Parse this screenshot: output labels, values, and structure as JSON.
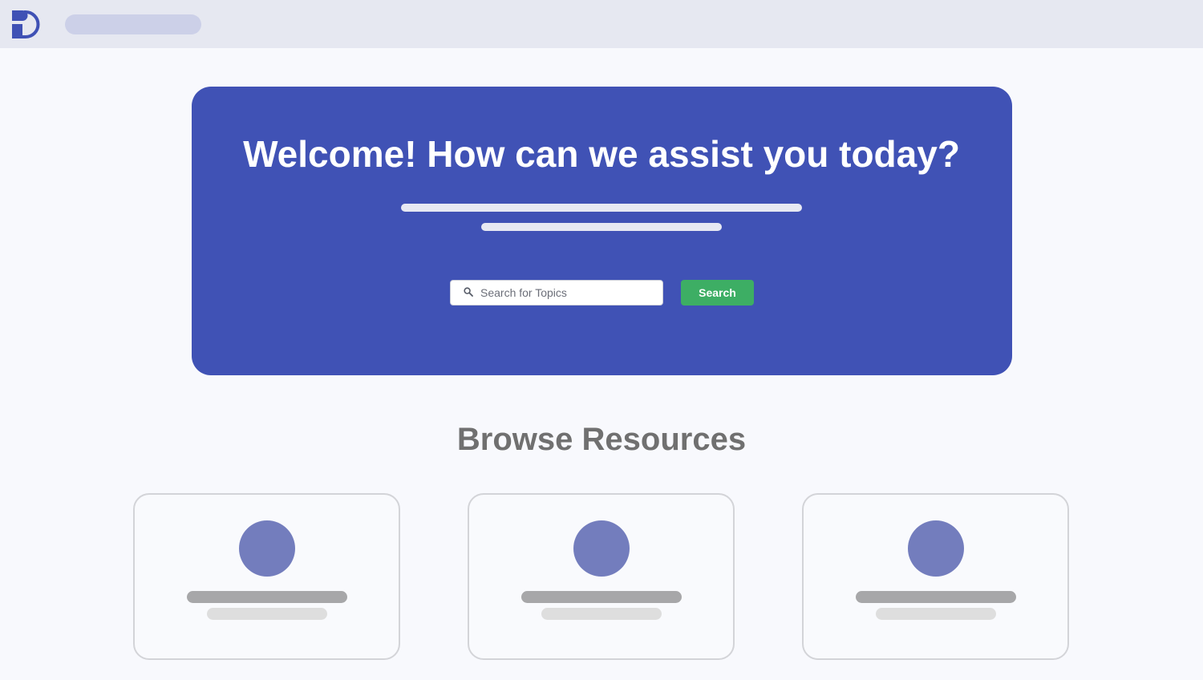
{
  "header": {
    "logo_icon": "brand-d-logo-icon",
    "brand_color": "#3f51b5"
  },
  "hero": {
    "title": "Welcome! How can we assist you today?",
    "background": "#4052b5"
  },
  "search": {
    "placeholder": "Search for Topics",
    "button_label": "Search",
    "icon": "search-icon",
    "button_color": "#3dae64"
  },
  "resources": {
    "heading": "Browse Resources",
    "cards": [
      {
        "icon": "resource-circle-icon"
      },
      {
        "icon": "resource-circle-icon"
      },
      {
        "icon": "resource-circle-icon"
      }
    ]
  }
}
